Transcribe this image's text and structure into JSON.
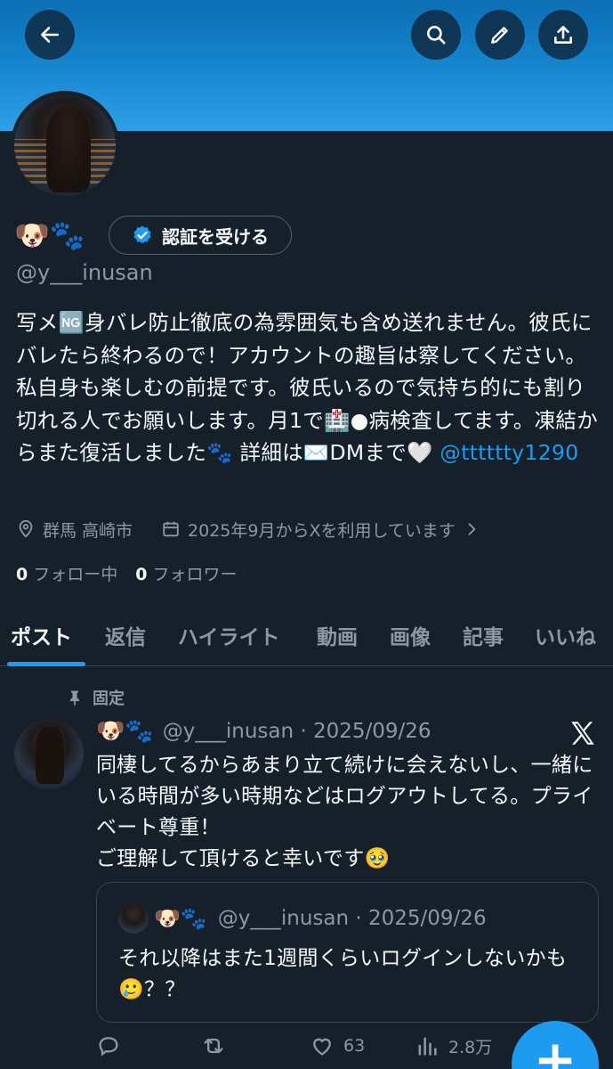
{
  "header": {
    "back_icon": "back-arrow-icon",
    "search_icon": "search-icon",
    "edit_icon": "pencil-icon",
    "share_icon": "share-icon"
  },
  "profile": {
    "name_emoji": "🐶🐾",
    "verify_label": "認証を受ける",
    "handle": "@y___inusan",
    "bio_text": "写メ🆖身バレ防止徹底の為雰囲気も含め送れません。彼氏にバレたら終わるので！アカウントの趣旨は察してください。私自身も楽しむの前提です。彼氏いるので気持ち的にも割り切れる人でお願いします。月1で🏥●病検査してます。凍結からまた復活しました🐾 詳細は✉️DMまで🤍",
    "bio_mention": "@tttttty1290",
    "location": "群馬 高崎市",
    "joined": "2025年9月からXを利用しています",
    "following_count": "0",
    "following_label": "フォロー中",
    "followers_count": "0",
    "followers_label": "フォロワー"
  },
  "tabs": [
    "ポスト",
    "返信",
    "ハイライト",
    "動画",
    "画像",
    "記事",
    "いいね"
  ],
  "post": {
    "pinned_label": "固定",
    "author_emoji": "🐶🐾",
    "handle_date": "@y___inusan · 2025/09/26",
    "text": "同棲してるからあまり立て続けに会えないし、一緒にいる時間が多い時期などはログアウトしてる。プライベート尊重！\nご理解して頂けると幸いです🥹",
    "quote": {
      "author_emoji": "🐶🐾",
      "handle_date": "@y___inusan · 2025/09/26",
      "text": "それ以降はまた1週間くらいログインしないかも🥲？？"
    },
    "likes": "63",
    "views": "2.8万"
  },
  "fab_label": "+",
  "colors": {
    "background": "#15202b",
    "accent": "#1d9bf0",
    "muted": "#8b98a5"
  }
}
